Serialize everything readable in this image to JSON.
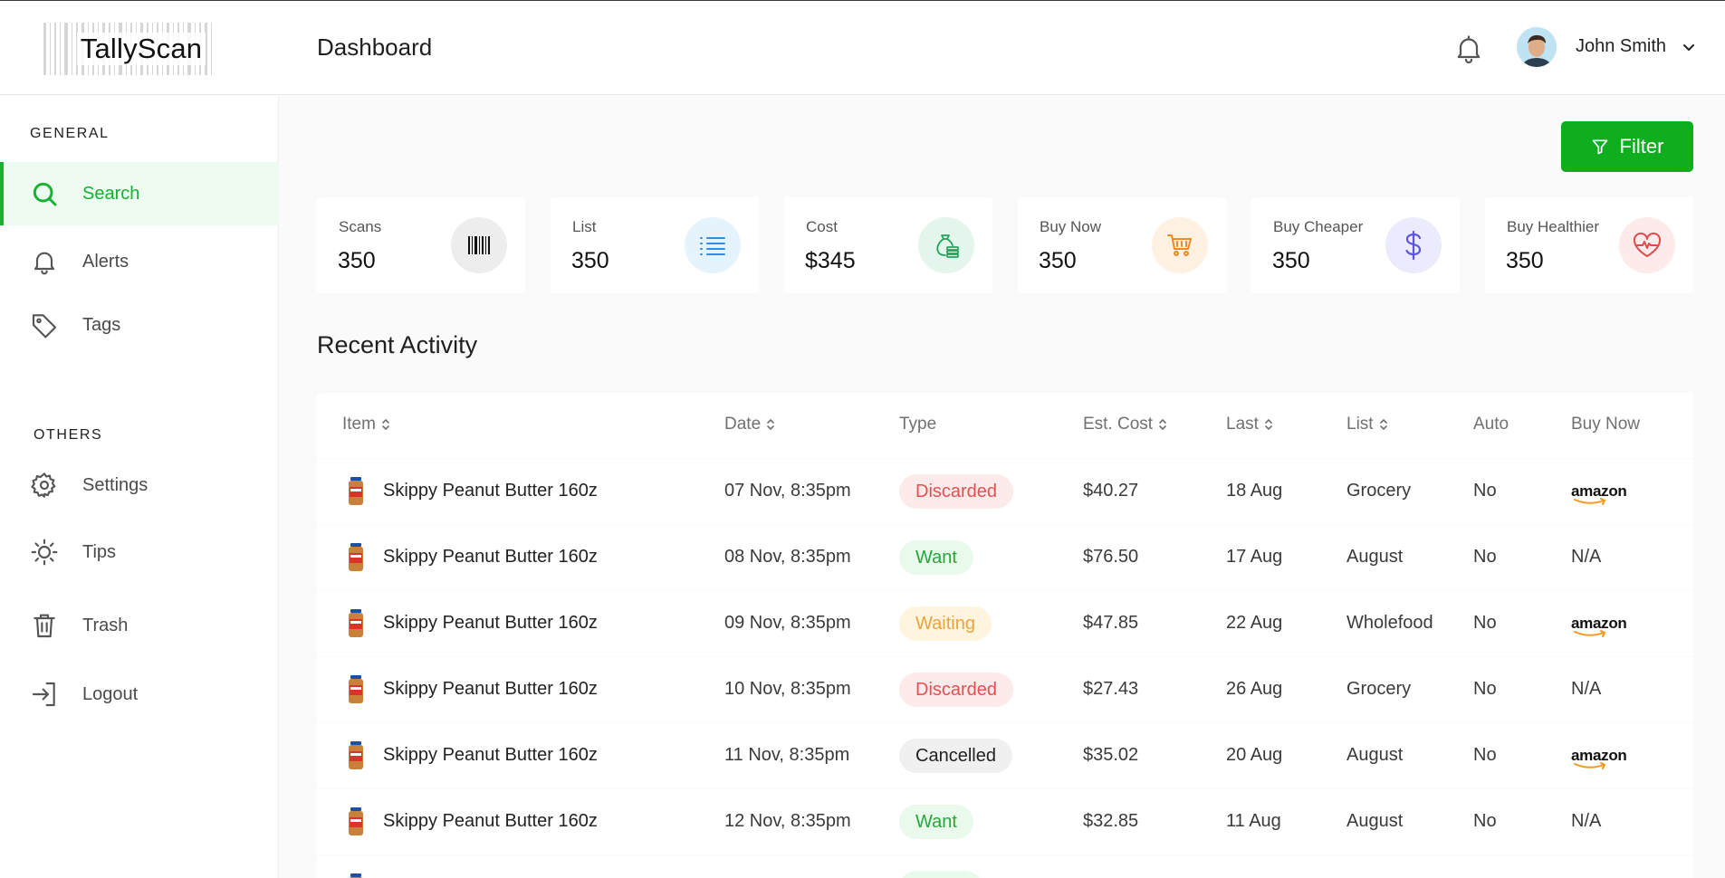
{
  "app": {
    "brand": "TallyScan",
    "page_title": "Dashboard"
  },
  "user": {
    "name": "John Smith"
  },
  "sidebar": {
    "general_label": "GENERAL",
    "others_label": "OTHERS",
    "items": [
      {
        "label": "Search",
        "icon": "search-icon",
        "active": true
      },
      {
        "label": "Alerts",
        "icon": "bell-icon"
      },
      {
        "label": "Tags",
        "icon": "tag-icon"
      },
      {
        "label": "Settings",
        "icon": "gear-icon"
      },
      {
        "label": "Tips",
        "icon": "sun-icon"
      },
      {
        "label": "Trash",
        "icon": "trash-icon"
      },
      {
        "label": "Logout",
        "icon": "logout-icon"
      }
    ]
  },
  "filter": {
    "label": "Filter"
  },
  "stats": [
    {
      "label": "Scans",
      "value": "350",
      "icon": "barcode-icon",
      "icon_bg": "#ededed",
      "icon_color": "#111111"
    },
    {
      "label": "List",
      "value": "350",
      "icon": "list-icon",
      "icon_bg": "#e5f3fd",
      "icon_color": "#2f8ee6"
    },
    {
      "label": "Cost",
      "value": "$345",
      "icon": "money-bag-icon",
      "icon_bg": "#e4f6ec",
      "icon_color": "#22a45a"
    },
    {
      "label": "Buy Now",
      "value": "350",
      "icon": "cart-icon",
      "icon_bg": "#fff1e2",
      "icon_color": "#f08a24"
    },
    {
      "label": "Buy Cheaper",
      "value": "350",
      "icon": "dollar-icon",
      "icon_bg": "#ecebfd",
      "icon_color": "#5b55e0"
    },
    {
      "label": "Buy Healthier",
      "value": "350",
      "icon": "heart-pulse-icon",
      "icon_bg": "#fdeaea",
      "icon_color": "#e04a4a"
    }
  ],
  "activity": {
    "title": "Recent Activity",
    "columns": [
      "Item",
      "Date",
      "Type",
      "Est. Cost",
      "Last",
      "List",
      "Auto",
      "Buy Now"
    ],
    "amazon_label": "amazon",
    "rows": [
      {
        "item": "Skippy Peanut Butter 160z",
        "date": "07 Nov, 8:35pm",
        "type": "Discarded",
        "cost": "$40.27",
        "last": "18 Aug",
        "list": "Grocery",
        "auto": "No",
        "buy_now": "amazon"
      },
      {
        "item": "Skippy Peanut Butter 160z",
        "date": "08 Nov, 8:35pm",
        "type": "Want",
        "cost": "$76.50",
        "last": "17 Aug",
        "list": "August",
        "auto": "No",
        "buy_now": "N/A"
      },
      {
        "item": "Skippy Peanut Butter 160z",
        "date": "09 Nov, 8:35pm",
        "type": "Waiting",
        "cost": "$47.85",
        "last": "22 Aug",
        "list": "Wholefood",
        "auto": "No",
        "buy_now": "amazon"
      },
      {
        "item": "Skippy Peanut Butter 160z",
        "date": "10 Nov, 8:35pm",
        "type": "Discarded",
        "cost": "$27.43",
        "last": "26 Aug",
        "list": "Grocery",
        "auto": "No",
        "buy_now": "N/A"
      },
      {
        "item": "Skippy Peanut Butter 160z",
        "date": "11 Nov, 8:35pm",
        "type": "Cancelled",
        "cost": "$35.02",
        "last": "20 Aug",
        "list": "August",
        "auto": "No",
        "buy_now": "amazon"
      },
      {
        "item": "Skippy Peanut Butter 160z",
        "date": "12 Nov, 8:35pm",
        "type": "Want",
        "cost": "$32.85",
        "last": "11 Aug",
        "list": "August",
        "auto": "No",
        "buy_now": "N/A"
      }
    ]
  },
  "colors": {
    "accent": "#0fae1f",
    "active_bg": "#eefbf0"
  }
}
